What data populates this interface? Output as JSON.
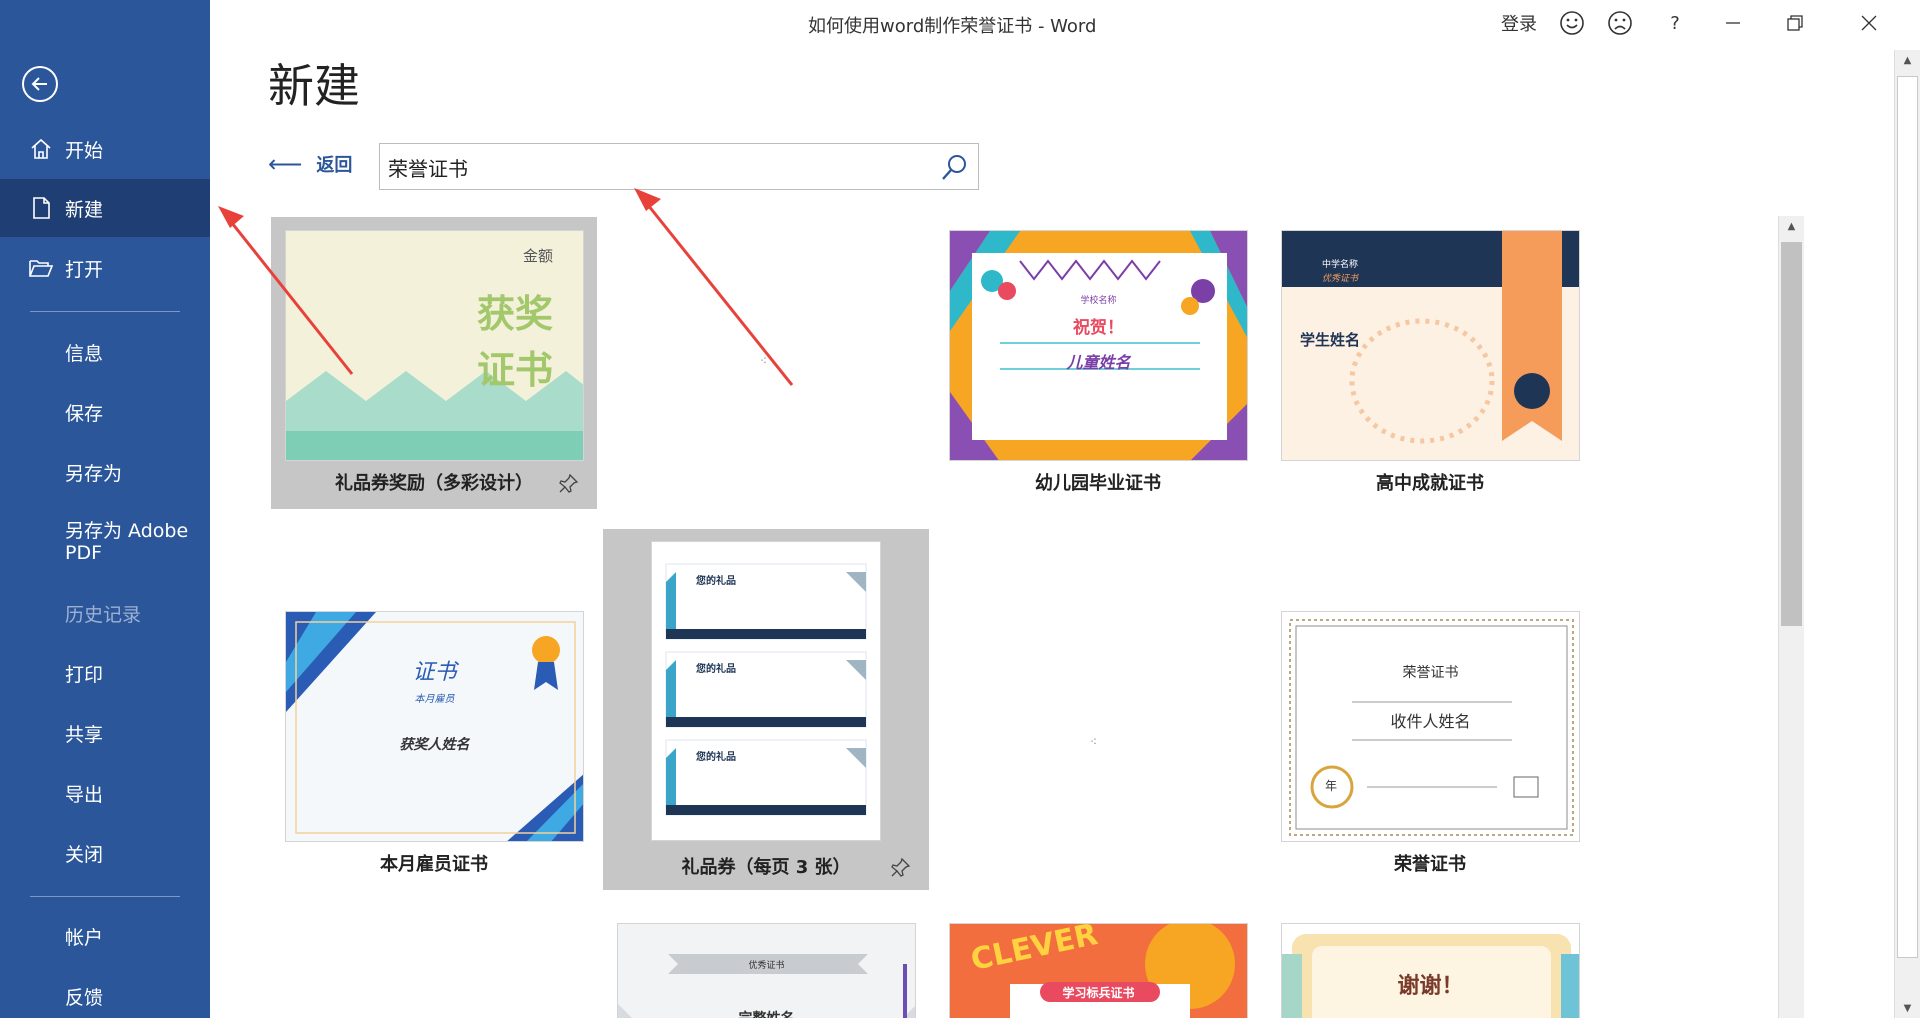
{
  "window": {
    "title": "如何使用word制作荣誉证书  -  Word",
    "signin": "登录",
    "help": "?"
  },
  "sidebar": {
    "items": [
      {
        "label": "开始",
        "icon": "home-icon"
      },
      {
        "label": "新建",
        "icon": "new-document-icon"
      },
      {
        "label": "打开",
        "icon": "folder-open-icon"
      },
      {
        "label": "信息"
      },
      {
        "label": "保存"
      },
      {
        "label": "另存为"
      },
      {
        "label": "另存为 Adobe PDF"
      },
      {
        "label": "历史记录"
      },
      {
        "label": "打印"
      },
      {
        "label": "共享"
      },
      {
        "label": "导出"
      },
      {
        "label": "关闭"
      },
      {
        "label": "帐户"
      },
      {
        "label": "反馈"
      }
    ]
  },
  "main": {
    "heading": "新建",
    "back_label": "返回",
    "search_value": "荣誉证书"
  },
  "templates": [
    {
      "name": "礼品券奖励（多彩设计）",
      "thumb_text": [
        "金额",
        "获奖",
        "证书"
      ]
    },
    {
      "name": "幼儿园毕业证书",
      "thumb_text": [
        "学校名称",
        "祝贺！",
        "儿童姓名"
      ]
    },
    {
      "name": "高中成就证书",
      "thumb_text": [
        "中学名称",
        "优秀证书",
        "学生姓名"
      ]
    },
    {
      "name": "本月雇员证书",
      "thumb_text": [
        "证书",
        "本月雇员",
        "获奖人姓名"
      ]
    },
    {
      "name": "礼品券（每页 3 张）",
      "thumb_text": [
        "您的礼品",
        "您的礼品",
        "您的礼品"
      ]
    },
    {
      "name": "荣誉证书",
      "thumb_text": [
        "荣誉证书",
        "收件人姓名",
        "年"
      ]
    },
    {
      "name": "",
      "thumb_text": [
        "优秀证书",
        "完整姓名"
      ]
    },
    {
      "name": "",
      "thumb_text": [
        "CLEVER",
        "学习标兵证书"
      ]
    },
    {
      "name": "",
      "thumb_text": [
        "谢谢！"
      ]
    }
  ],
  "colors": {
    "sidebar": "#2b579a",
    "sidebar_active": "#1f3f74",
    "arrow": "#e8413a"
  }
}
